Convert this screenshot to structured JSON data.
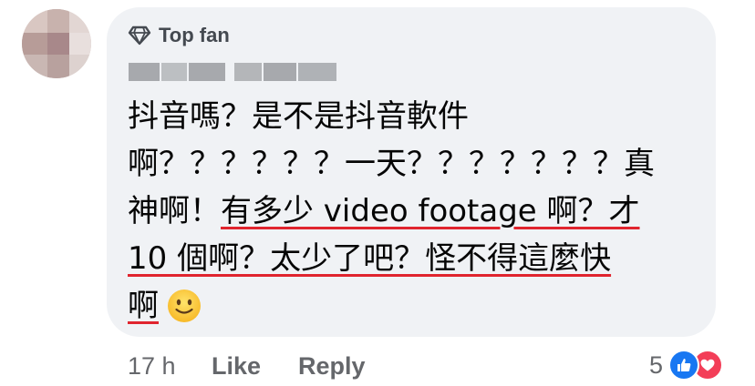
{
  "comment": {
    "badge_label": "Top fan",
    "text_lines": [
      {
        "plain": "抖音嗎？是不是抖音軟件",
        "underlined": ""
      },
      {
        "plain": "啊？？？？？？一天？？？？？？？真",
        "underlined": ""
      },
      {
        "plain": "神啊！",
        "underlined": "有多少 video footage 啊？才"
      },
      {
        "plain": "",
        "underlined": "10 個啊？太少了吧？怪不得這麼快"
      },
      {
        "plain": "",
        "underlined": "啊"
      }
    ],
    "emoji_name": "slightly-smiling-face"
  },
  "footer": {
    "time": "17 h",
    "like_label": "Like",
    "reply_label": "Reply",
    "reaction_count": "5",
    "reactions": [
      "like",
      "love"
    ]
  },
  "colors": {
    "bubble": "#f0f2f5",
    "underline": "#e0242e",
    "like_blue": "#1877f2",
    "love_red": "#f33e58"
  }
}
